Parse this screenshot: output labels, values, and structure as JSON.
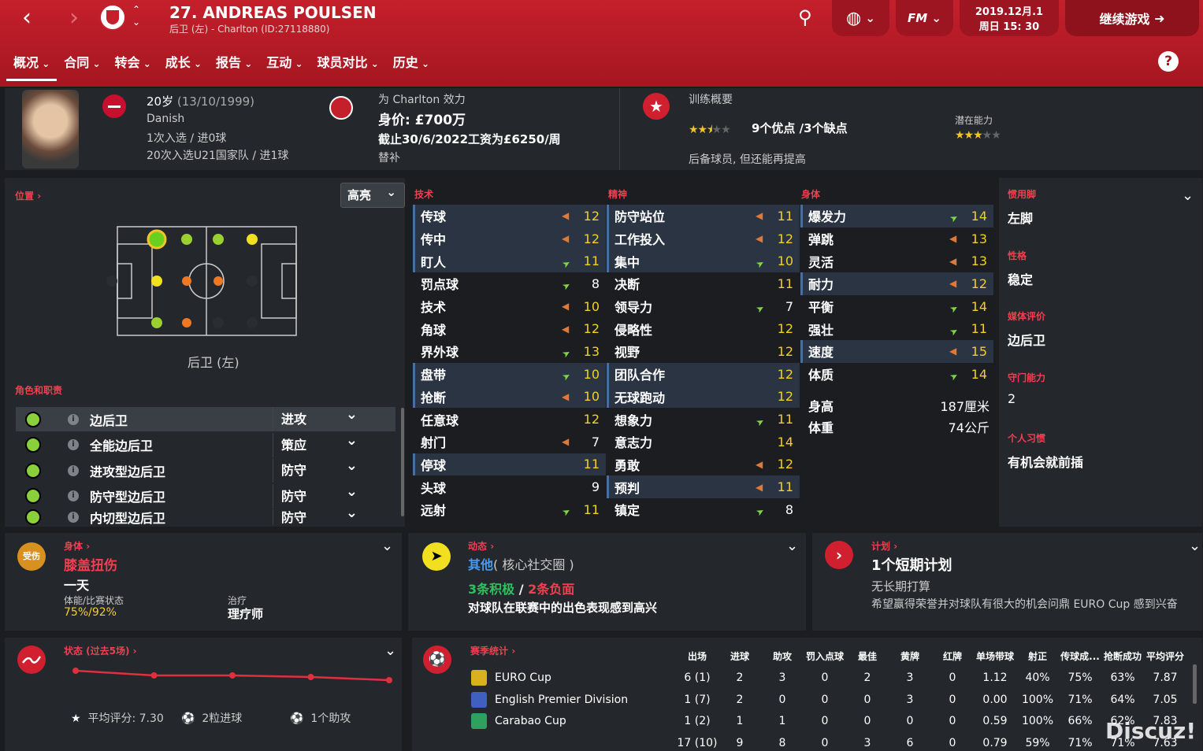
{
  "header": {
    "title": "27. ANDREAS POULSEN",
    "subtitle": "后卫 (左) - Charlton (ID:27118880)",
    "back_icon": "‹",
    "forward_icon": "›"
  },
  "date": {
    "line1": "2019.12月.1",
    "line2": "周日 15: 30"
  },
  "continue_label": "继续游戏",
  "tabs": [
    "概况",
    "合同",
    "转会",
    "成长",
    "报告",
    "互动",
    "球员对比",
    "历史"
  ],
  "player": {
    "age_dob": "20岁",
    "dob": "(13/10/1999)",
    "nationality": "Danish",
    "caps": "1次入选 / 进0球",
    "u21": "20次入选U21国家队 / 进1球"
  },
  "club": {
    "plays_for": "为 Charlton 效力",
    "value": "身价: £700万",
    "contract": "截止30/6/2022工资为£6250/周",
    "status": "替补"
  },
  "training": {
    "title": "训练概要",
    "summary": "9个优点 /3个缺点",
    "potential_label": "潜在能力",
    "current_stars": 2.5,
    "potential_stars": 3,
    "desc": "后备球员, 但还能再提高"
  },
  "position": {
    "label": "位置",
    "highlight": "高亮",
    "name": "后卫 (左)"
  },
  "roles_label": "角色和职责",
  "roles": [
    {
      "name": "边后卫",
      "duty": "进攻"
    },
    {
      "name": "全能边后卫",
      "duty": "策应"
    },
    {
      "name": "进攻型边后卫",
      "duty": "防守"
    },
    {
      "name": "防守型边后卫",
      "duty": "防守"
    },
    {
      "name": "内切型边后卫",
      "duty": "防守"
    }
  ],
  "cat": {
    "tech": "技术",
    "mental": "精神",
    "phys": "身体"
  },
  "tech": [
    [
      "传球",
      "dn",
      "12",
      true
    ],
    [
      "传中",
      "dn",
      "12",
      true
    ],
    [
      "盯人",
      "up",
      "11",
      true
    ],
    [
      "罚点球",
      "up",
      "8",
      false
    ],
    [
      "技术",
      "dn",
      "10",
      false
    ],
    [
      "角球",
      "dn",
      "12",
      false
    ],
    [
      "界外球",
      "up",
      "13",
      false
    ],
    [
      "盘带",
      "up",
      "10",
      true
    ],
    [
      "抢断",
      "dn",
      "10",
      true
    ],
    [
      "任意球",
      "",
      "12",
      false
    ],
    [
      "射门",
      "dn",
      "7",
      false
    ],
    [
      "停球",
      "",
      "11",
      true
    ],
    [
      "头球",
      "",
      "9",
      false
    ],
    [
      "远射",
      "up",
      "11",
      false
    ]
  ],
  "mental": [
    [
      "防守站位",
      "dn",
      "11",
      true
    ],
    [
      "工作投入",
      "dn",
      "12",
      true
    ],
    [
      "集中",
      "up",
      "10",
      true
    ],
    [
      "决断",
      "",
      "11",
      false
    ],
    [
      "领导力",
      "up",
      "7",
      false
    ],
    [
      "侵略性",
      "",
      "12",
      false
    ],
    [
      "视野",
      "",
      "12",
      false
    ],
    [
      "团队合作",
      "",
      "12",
      true
    ],
    [
      "无球跑动",
      "",
      "12",
      true
    ],
    [
      "想象力",
      "up",
      "11",
      false
    ],
    [
      "意志力",
      "",
      "14",
      false
    ],
    [
      "勇敢",
      "dn",
      "12",
      false
    ],
    [
      "预判",
      "dn",
      "11",
      true
    ],
    [
      "镇定",
      "up",
      "8",
      false
    ]
  ],
  "phys": [
    [
      "爆发力",
      "up",
      "14",
      true
    ],
    [
      "弹跳",
      "dn",
      "13",
      false
    ],
    [
      "灵活",
      "dn",
      "13",
      false
    ],
    [
      "耐力",
      "dn",
      "12",
      true
    ],
    [
      "平衡",
      "up",
      "14",
      false
    ],
    [
      "强壮",
      "up",
      "11",
      false
    ],
    [
      "速度",
      "dn",
      "15",
      true
    ],
    [
      "体质",
      "up",
      "14",
      false
    ]
  ],
  "body": {
    "height_label": "身高",
    "height": "187厘米",
    "weight_label": "体重",
    "weight": "74公斤"
  },
  "side": [
    {
      "label": "惯用脚",
      "value": "左脚"
    },
    {
      "label": "性格",
      "value": "稳定"
    },
    {
      "label": "媒体评价",
      "value": "边后卫"
    },
    {
      "label": "守门能力",
      "value": "2"
    },
    {
      "label": "个人习惯",
      "value": "有机会就前插"
    }
  ],
  "injury": {
    "label": "身体",
    "badge": "受伤",
    "name": "膝盖扭伤",
    "duration": "一天",
    "fitness_label": "体能/比赛状态",
    "fitness": "75%/92%",
    "treat_label": "治疗",
    "treat": "理疗师"
  },
  "dynamics": {
    "label": "动态",
    "group": "其他",
    "group_sub": "( 核心社交圈 )",
    "pos": "3条积极",
    "sep": " / ",
    "neg": "2条负面",
    "text": "对球队在联赛中的出色表现感到高兴"
  },
  "plan": {
    "label": "计划",
    "title": "1个短期计划",
    "sub": "无长期打算",
    "text": "希望赢得荣誉并对球队有很大的机会问鼎 EURO Cup 感到兴奋"
  },
  "form": {
    "label": "状态 (过去5场)",
    "rating": "平均评分: 7.30",
    "goals": "2粒进球",
    "assists": "1个助攻",
    "values": [
      7.9,
      7.6,
      7.6,
      7.5,
      7.3
    ]
  },
  "stats": {
    "label": "赛季统计",
    "headers": [
      "出场",
      "进球",
      "助攻",
      "罚入点球",
      "最佳",
      "黄牌",
      "红牌",
      "单场带球",
      "射正",
      "传球成...",
      "抢断成功",
      "平均评分"
    ],
    "rows": [
      {
        "comp": "EURO Cup",
        "color": "#d8b020",
        "vals": [
          "6 (1)",
          "2",
          "3",
          "0",
          "2",
          "3",
          "0",
          "1.12",
          "40%",
          "75%",
          "63%",
          "7.87"
        ]
      },
      {
        "comp": "English Premier Division",
        "color": "#4060c0",
        "vals": [
          "1 (7)",
          "2",
          "0",
          "0",
          "0",
          "3",
          "0",
          "0.00",
          "100%",
          "71%",
          "64%",
          "7.05"
        ]
      },
      {
        "comp": "Carabao Cup",
        "color": "#30a060",
        "vals": [
          "1 (2)",
          "1",
          "1",
          "0",
          "0",
          "0",
          "0",
          "0.59",
          "100%",
          "66%",
          "62%",
          "7.83"
        ]
      },
      {
        "comp": "",
        "color": "",
        "vals": [
          "17 (10)",
          "9",
          "8",
          "0",
          "3",
          "6",
          "0",
          "0.79",
          "59%",
          "71%",
          "71%",
          "7.63"
        ]
      }
    ]
  },
  "watermark": "Discuz!"
}
